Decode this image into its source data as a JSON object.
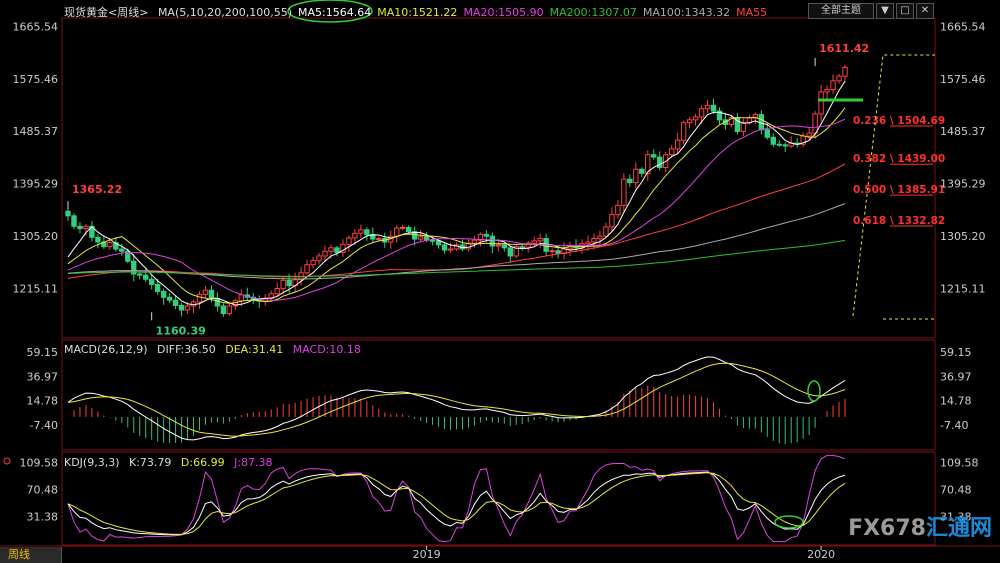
{
  "header": {
    "symbol": "现货黄金",
    "period": "<周线>",
    "ma_params": "MA(5,10,20,200,100,55)",
    "ma_values": [
      {
        "label": "MA5:1564.64",
        "color": "#ffffff"
      },
      {
        "label": "MA10:1521.22",
        "color": "#e8e830"
      },
      {
        "label": "MA20:1505.90",
        "color": "#e040e0"
      },
      {
        "label": "MA200:1307.07",
        "color": "#30c030"
      },
      {
        "label": "MA100:1343.32",
        "color": "#aaaaaa"
      },
      {
        "label": "MA55",
        "color": "#ff4040"
      }
    ]
  },
  "controls": {
    "theme_select": "全部主题",
    "toggle_symbol": "▼"
  },
  "macd_header": {
    "params": "MACD(26,12,9)",
    "diff": "DIFF:36.50",
    "dea": "DEA:31.41",
    "macd": "MACD:10.18"
  },
  "kdj_header": {
    "params": "KDJ(9,3,3)",
    "k": "K:73.79",
    "d": "D:66.99",
    "j": "J:87.38"
  },
  "timeframe_tab": "周线",
  "watermark": {
    "a": "FX678",
    "b": "汇通网"
  },
  "colors": {
    "up": "#ff4040",
    "down": "#30d080",
    "macd_up": "#ff4040",
    "macd_down": "#30c080"
  },
  "chart_data": [
    {
      "type": "candlestick",
      "title": "",
      "y_ticks": [
        1665.54,
        1575.46,
        1485.37,
        1395.29,
        1305.2,
        1215.11
      ],
      "x_ticks": [
        "2019",
        "2020"
      ],
      "ylim": [
        1130,
        1680
      ],
      "annotations": [
        {
          "text": "1365.22",
          "kind": "high"
        },
        {
          "text": "1160.39",
          "kind": "low"
        },
        {
          "text": "1611.42",
          "kind": "high"
        }
      ],
      "fib_levels": [
        {
          "ratio": "0.236",
          "label": "0.236 \\ 1504.69",
          "value": 1504.69
        },
        {
          "ratio": "0.382",
          "label": "0.382 \\ 1439.00",
          "value": 1439.0
        },
        {
          "ratio": "0.500",
          "label": "0.500 \\ 1385.91",
          "value": 1385.91
        },
        {
          "ratio": "0.618",
          "label": "0.618 \\ 1332.82",
          "value": 1332.82
        }
      ],
      "weekly_close": [
        1340,
        1322,
        1318,
        1322,
        1303,
        1295,
        1287,
        1294,
        1283,
        1279,
        1262,
        1240,
        1238,
        1231,
        1222,
        1210,
        1200,
        1195,
        1186,
        1178,
        1185,
        1192,
        1205,
        1212,
        1198,
        1185,
        1172,
        1185,
        1194,
        1204,
        1200,
        1196,
        1193,
        1198,
        1206,
        1215,
        1229,
        1220,
        1230,
        1242,
        1256,
        1263,
        1271,
        1279,
        1285,
        1277,
        1291,
        1302,
        1310,
        1316,
        1308,
        1300,
        1301,
        1295,
        1305,
        1319,
        1320,
        1313,
        1300,
        1304,
        1298,
        1297,
        1290,
        1281,
        1283,
        1290,
        1283,
        1293,
        1298,
        1308,
        1305,
        1288,
        1290,
        1285,
        1271,
        1287,
        1286,
        1293,
        1297,
        1301,
        1279,
        1280,
        1275,
        1283,
        1288,
        1285,
        1292,
        1295,
        1301,
        1305,
        1321,
        1342,
        1358,
        1403,
        1397,
        1420,
        1413,
        1445,
        1441,
        1423,
        1445,
        1455,
        1470,
        1500,
        1505,
        1510,
        1524,
        1530,
        1520,
        1505,
        1497,
        1509,
        1485,
        1500,
        1508,
        1514,
        1488,
        1475,
        1463,
        1462,
        1460,
        1465,
        1463,
        1477,
        1482,
        1515,
        1553,
        1557,
        1572,
        1580,
        1595
      ],
      "ma_series": [
        {
          "label": "MA5",
          "period": 5,
          "color": "#ffffff"
        },
        {
          "label": "MA10",
          "period": 10,
          "color": "#e8e830"
        },
        {
          "label": "MA20",
          "period": 20,
          "color": "#e040e0"
        },
        {
          "label": "MA55",
          "period": 55,
          "color": "#ff4040"
        },
        {
          "label": "MA100",
          "period": 100,
          "color": "#aaaaaa"
        },
        {
          "label": "MA200",
          "period": 200,
          "color": "#30c030"
        }
      ]
    },
    {
      "type": "macd",
      "y_ticks": [
        59.15,
        36.97,
        14.78,
        -7.4
      ],
      "ylim": [
        -30,
        70
      ],
      "diff": 36.5,
      "dea": 31.41,
      "macd": 10.18
    },
    {
      "type": "kdj",
      "y_ticks": [
        109.58,
        70.48,
        31.38
      ],
      "ylim": [
        -10,
        125
      ],
      "k": 73.79,
      "d": 66.99,
      "j": 87.38
    }
  ]
}
